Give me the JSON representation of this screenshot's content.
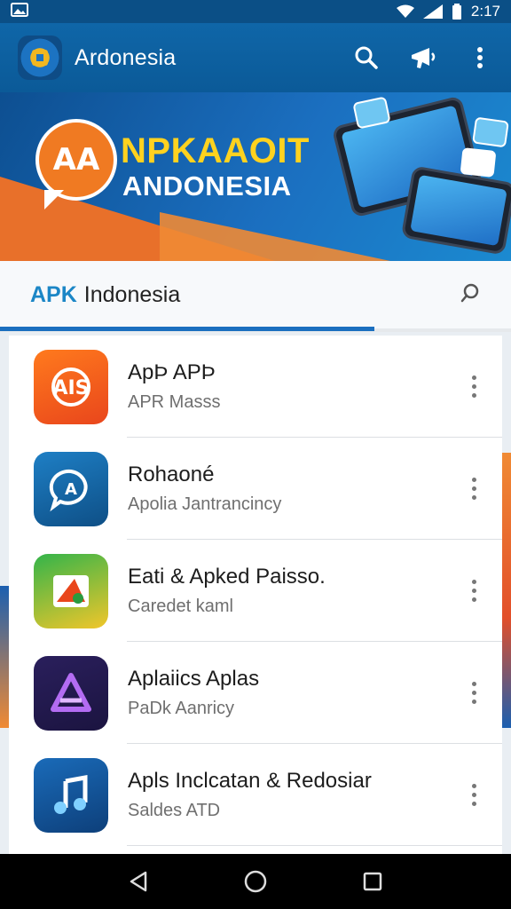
{
  "status_bar": {
    "time": "2:17",
    "icons": [
      "gallery-icon",
      "wifi-icon",
      "signal-icon",
      "battery-icon"
    ]
  },
  "app_bar": {
    "title": "Ardonesia",
    "actions": [
      "search-icon",
      "megaphone-icon",
      "more-vert-icon"
    ]
  },
  "banner": {
    "logo_text": "AA",
    "headline": "NPKAAOIT",
    "subheadline": "ANDONESIA"
  },
  "search_header": {
    "brand": "APK",
    "name": "Indonesia"
  },
  "apps": [
    {
      "title": "ApÞ APÞ",
      "subtitle": "APR Masss",
      "icon": "ais-logo-icon",
      "icon_text": "AIS",
      "color": "#f2621f"
    },
    {
      "title": "Rohaoné",
      "subtitle": "Apolia Jantrancincy",
      "icon": "chat-bubble-icon",
      "icon_text": "A",
      "color": "#155e9e"
    },
    {
      "title": "Eati & Apked Paisso.",
      "subtitle": "Caredet kaml",
      "icon": "flag-icon",
      "icon_text": "",
      "color": "#33b44a"
    },
    {
      "title": "Aplaiics Aplas",
      "subtitle": "PaDk Aanricy",
      "icon": "triangle-a-icon",
      "icon_text": "A",
      "color": "#2a1f5c"
    },
    {
      "title": "Apls Inclcatan & Redosiar",
      "subtitle": "Saldes ATD",
      "icon": "music-note-icon",
      "icon_text": "♫",
      "color": "#1a6bb9"
    }
  ],
  "nav_bar": [
    "back-icon",
    "home-icon",
    "recents-icon"
  ]
}
